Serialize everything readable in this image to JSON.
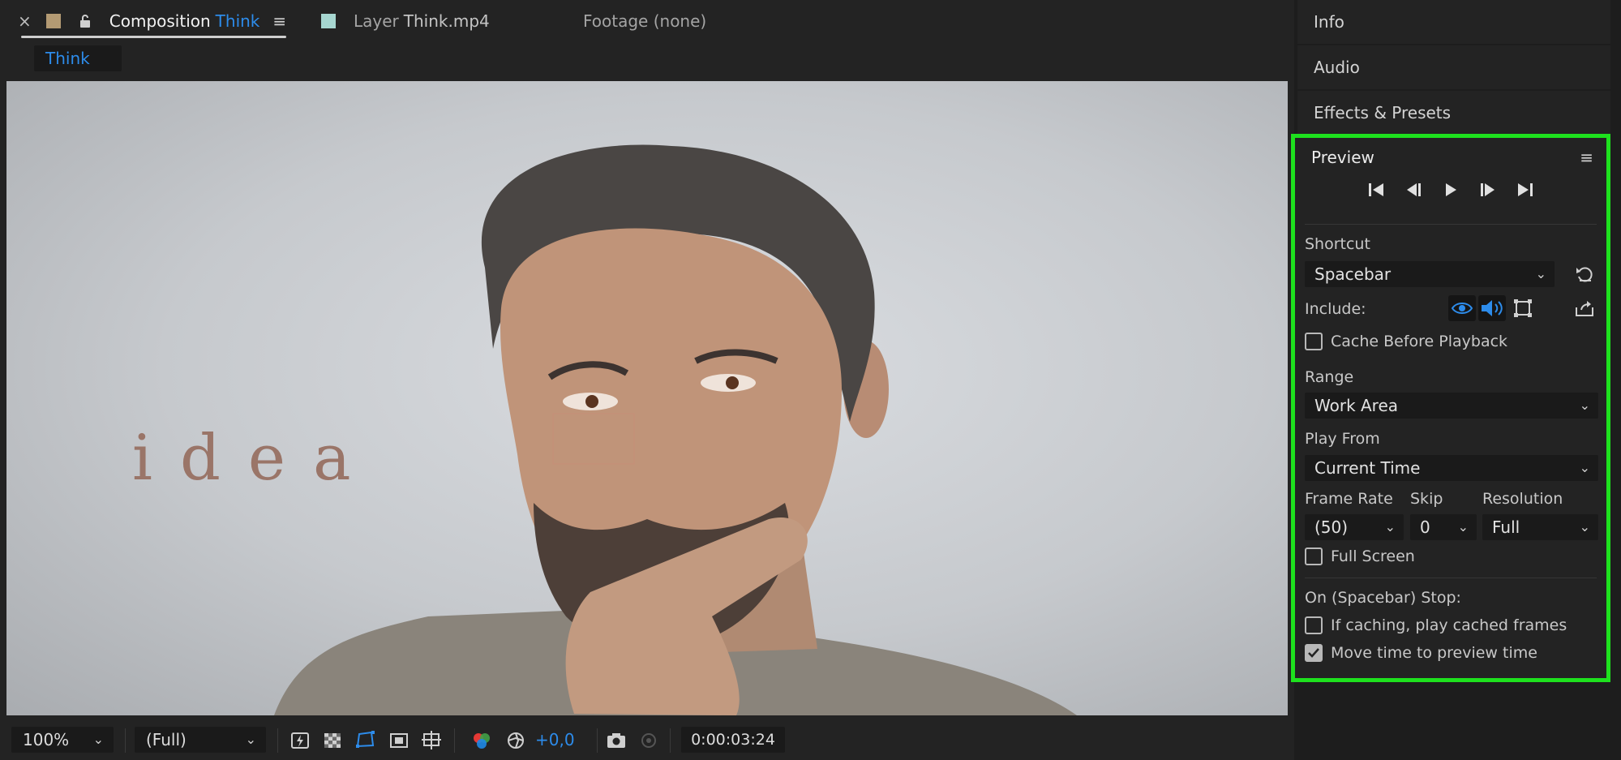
{
  "composition_tabs": {
    "active": {
      "close": "×",
      "prefix": "Composition",
      "name": "Think",
      "menu": "≡"
    },
    "layer": {
      "prefix": "Layer",
      "name": "Think.mp4"
    },
    "footage": {
      "label": "Footage (none)"
    }
  },
  "breadcrumb": {
    "label": "Think"
  },
  "viewer": {
    "overlay_text": "idea",
    "zoom": "100%",
    "resolution": "(Full)",
    "exposure": "+0,0",
    "timecode": "0:00:03:24"
  },
  "panels": {
    "info": "Info",
    "audio": "Audio",
    "effects": "Effects & Presets"
  },
  "preview": {
    "title": "Preview",
    "menu": "≡",
    "shortcut_label": "Shortcut",
    "shortcut_value": "Spacebar",
    "include_label": "Include:",
    "cache_before_playback": {
      "label": "Cache Before Playback",
      "checked": false
    },
    "range_label": "Range",
    "range_value": "Work Area",
    "play_from_label": "Play From",
    "play_from_value": "Current Time",
    "frame_rate_label": "Frame Rate",
    "frame_rate_value": "(50)",
    "skip_label": "Skip",
    "skip_value": "0",
    "resolution_label": "Resolution",
    "resolution_value": "Full",
    "full_screen": {
      "label": "Full Screen",
      "checked": false
    },
    "on_stop_label": "On (Spacebar) Stop:",
    "if_caching": {
      "label": "If caching, play cached frames",
      "checked": false
    },
    "move_time": {
      "label": "Move time to preview time",
      "checked": true
    }
  },
  "colors": {
    "accent_blue": "#2d8ceb",
    "highlight_green": "#1ee11e",
    "panel_bg": "#232323",
    "idea_text": "#9a7568"
  }
}
